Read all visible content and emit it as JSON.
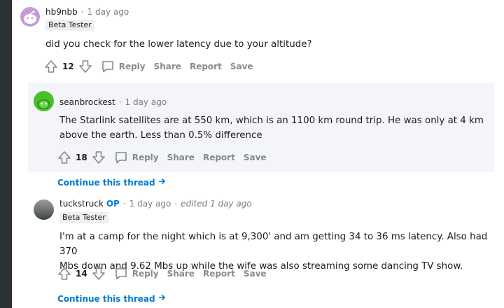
{
  "comments": [
    {
      "username": "hb9nbb",
      "time": "1 day ago",
      "flair": "Beta Tester",
      "body": "did you check for the lower latency due to your altitude?",
      "score": "12"
    },
    {
      "username": "seanbrockest",
      "time": "1 day ago",
      "body_lines": [
        "The Starlink satellites are at 550 km, which is an 1100 km round trip. He was only at 4 km",
        "above the earth. Less than 0.5% difference"
      ],
      "score": "18"
    },
    {
      "username": "tuckstruck",
      "op_badge": "OP",
      "time": "1 day ago",
      "edited": "edited 1 day ago",
      "flair": "Beta Tester",
      "body_lines": [
        "I'm at a camp for the night which is at 9,300' and am getting 34 to 36 ms latency. Also had 370",
        "Mbs down and 9.62 Mbs up while the wife was also streaming some dancing TV show."
      ],
      "score": "14"
    }
  ],
  "actions": {
    "reply": "Reply",
    "share": "Share",
    "report": "Report",
    "save": "Save"
  },
  "continue_thread": "Continue this thread",
  "separator": "·",
  "icons": [
    "upvote-icon",
    "downvote-icon",
    "comment-icon",
    "arrow-right-icon"
  ],
  "colors": {
    "link": "#0079d3",
    "muted": "#878a8c",
    "highlight_bg": "#f3f5f9",
    "sidebar": "#2b3236"
  }
}
